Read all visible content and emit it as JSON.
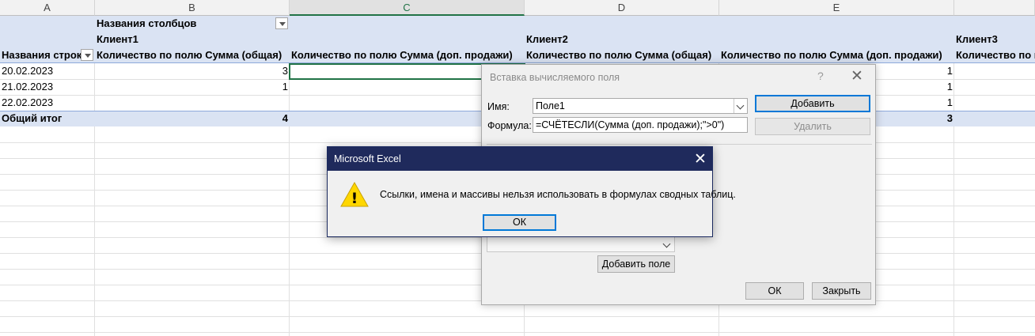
{
  "sheet": {
    "columns": [
      "A",
      "B",
      "C",
      "D",
      "E"
    ],
    "pivot": {
      "column_labels_header": "Названия столбцов",
      "row_labels_header": "Названия строк",
      "clients": [
        "Клиент1",
        "Клиент2",
        "Клиент3"
      ],
      "measure_headers": {
        "b": "Количество по полю Сумма (общая)",
        "c": "Количество по полю Сумма (доп. продажи)",
        "d": "Количество по полю Сумма (общая)",
        "e": "Количество по полю Сумма (доп. продажи)",
        "f": "Количество по по"
      },
      "rows": [
        {
          "label": "20.02.2023",
          "b": "3",
          "e": "1"
        },
        {
          "label": "21.02.2023",
          "b": "1",
          "e": "1"
        },
        {
          "label": "22.02.2023",
          "b": "",
          "e": "1"
        }
      ],
      "total": {
        "label": "Общий итог",
        "b": "4",
        "e": "3"
      }
    }
  },
  "calc_dialog": {
    "title": "Вставка вычисляемого поля",
    "help_glyph": "?",
    "close_glyph": "✕",
    "name_label": "Имя:",
    "name_value": "Поле1",
    "formula_label": "Формула:",
    "formula_value": "=СЧЁТЕСЛИ(Сумма (доп. продажи);\">0\")",
    "add_button": "Добавить",
    "delete_button": "Удалить",
    "insert_field_button": "Добавить поле",
    "ok_button": "ОК",
    "close_button": "Закрыть"
  },
  "message_box": {
    "title": "Microsoft Excel",
    "close_glyph": "✕",
    "message": "Ссылки, имена и массивы нельзя использовать в формулах сводных таблиц.",
    "ok_button": "ОК",
    "warning_glyph": "!"
  },
  "colors": {
    "accent_excel": "#217346",
    "pivot_band": "#dae3f3",
    "titlebar": "#1f2a5c",
    "focus": "#0078d7",
    "warning": "#ffd700"
  }
}
